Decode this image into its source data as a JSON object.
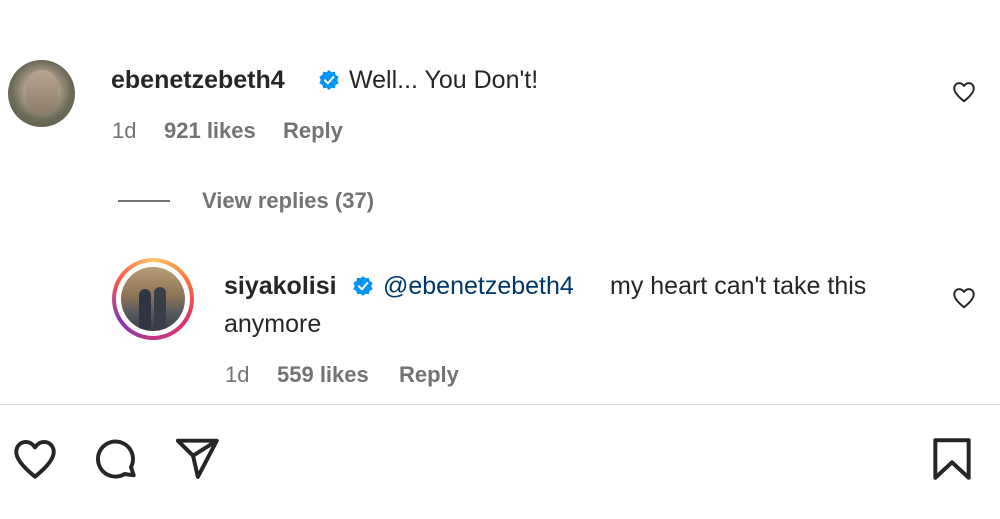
{
  "comments": [
    {
      "username": "ebenetzebeth4",
      "text": "Well... You Don't!",
      "time": "1d",
      "likes": "921 likes",
      "reply_label": "Reply"
    }
  ],
  "view_replies": "View replies (37)",
  "replies": [
    {
      "username": "siyakolisi",
      "mention": "@ebenetzebeth4",
      "text_line1": "my heart can't take this",
      "text_line2": "anymore",
      "time": "1d",
      "likes": "559 likes",
      "reply_label": "Reply"
    }
  ],
  "icons": {
    "verified": "verified-badge-icon",
    "like": "heart-icon",
    "actions": [
      "heart-icon",
      "comment-icon",
      "share-icon",
      "bookmark-icon"
    ]
  },
  "colors": {
    "verified_blue": "#0095f6",
    "mention_blue": "#00376b",
    "secondary_text": "#737373"
  }
}
